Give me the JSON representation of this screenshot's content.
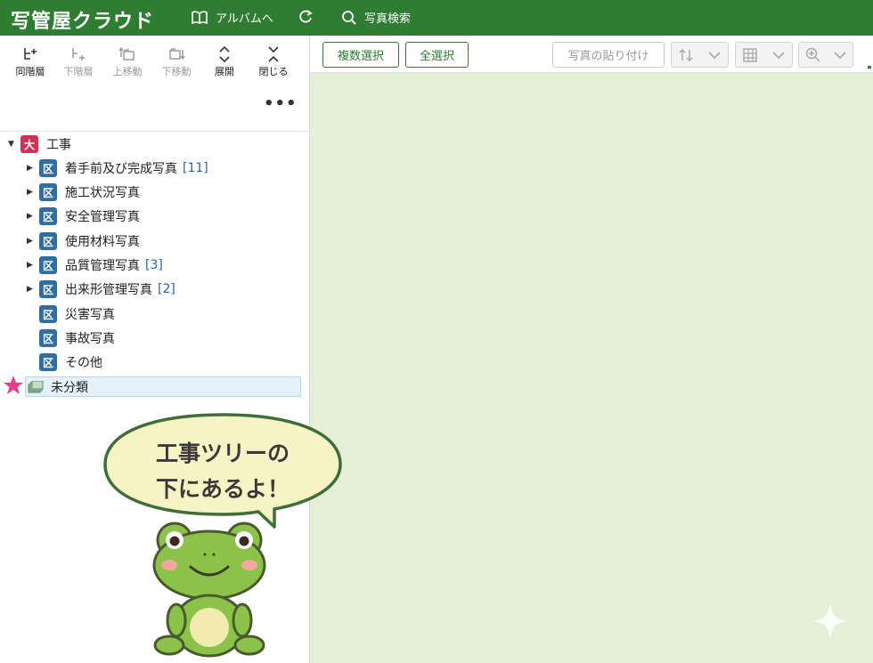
{
  "header": {
    "logo": "写管屋クラウド",
    "album_label": "アルバムへ",
    "search_label": "写真検索"
  },
  "toolbar": {
    "items": [
      {
        "label": "同階層",
        "enabled": true
      },
      {
        "label": "下階層",
        "enabled": false
      },
      {
        "label": "上移動",
        "enabled": false
      },
      {
        "label": "下移動",
        "enabled": false
      },
      {
        "label": "展開",
        "enabled": true
      },
      {
        "label": "閉じる",
        "enabled": true
      }
    ],
    "more": "•••"
  },
  "tree": {
    "root": {
      "badge": "大",
      "label": "工事"
    },
    "children": [
      {
        "badge": "区",
        "label": "着手前及び完成写真",
        "count": "[11]",
        "expandable": true
      },
      {
        "badge": "区",
        "label": "施工状況写真",
        "count": "",
        "expandable": true
      },
      {
        "badge": "区",
        "label": "安全管理写真",
        "count": "",
        "expandable": true
      },
      {
        "badge": "区",
        "label": "使用材料写真",
        "count": "",
        "expandable": true
      },
      {
        "badge": "区",
        "label": "品質管理写真",
        "count": "[3]",
        "expandable": true
      },
      {
        "badge": "区",
        "label": "出来形管理写真",
        "count": "[2]",
        "expandable": true
      },
      {
        "badge": "区",
        "label": "災害写真",
        "count": "",
        "expandable": false
      },
      {
        "badge": "区",
        "label": "事故写真",
        "count": "",
        "expandable": false
      },
      {
        "badge": "区",
        "label": "その他",
        "count": "",
        "expandable": false
      }
    ],
    "unclassified": "未分類"
  },
  "right_toolbar": {
    "multi_select": "複数選択",
    "select_all": "全選択",
    "paste_photo": "写真の貼り付け"
  },
  "callout": {
    "line1": "工事ツリーの",
    "line2": "下にあるよ！"
  },
  "colors": {
    "brand_green": "#2e7d32",
    "dai_badge": "#d32f57",
    "ku_badge": "#2f6da3",
    "content_bg": "#e4efd6"
  }
}
